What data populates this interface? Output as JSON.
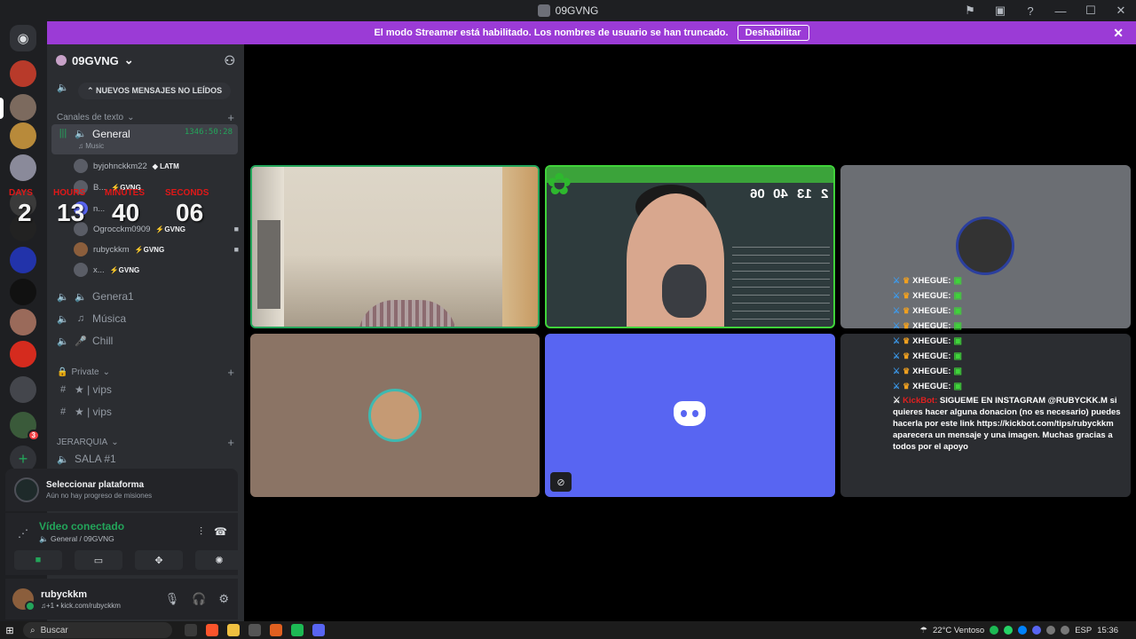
{
  "window": {
    "title": "09GVNG"
  },
  "banner": {
    "text": "El modo Streamer está habilitado. Los nombres de usuario se han truncado.",
    "button": "Deshabilitar"
  },
  "server": {
    "name": "09GVNG",
    "new_messages": "NUEVOS MENSAJES NO LEÍDOS"
  },
  "categories": {
    "text": "Canales de texto",
    "private": "Private",
    "jerarquia": "JERARQUIA"
  },
  "channels": {
    "general": {
      "name": "General",
      "sub": "Music",
      "timer": "1346:50:28"
    },
    "general1": "Genera1",
    "musica": "Música",
    "chill": "Chill",
    "vips1": "★ | vips",
    "vips2": "★ | vips",
    "sala1": "SALA #1"
  },
  "members": [
    {
      "name": "byjohnckkm22",
      "tag": "LATM"
    },
    {
      "name": "B...",
      "tag": "GVNG"
    },
    {
      "name": "n..."
    },
    {
      "name": "Ogrocckm0909",
      "tag": "GVNG"
    },
    {
      "name": "rubyckkm",
      "tag": "GVNG"
    },
    {
      "name": "x...",
      "tag": "GVNG"
    }
  ],
  "overlay_timer": {
    "days_label": "DAYS",
    "hours_label": "HOURS",
    "minutes_label": "MINUTES",
    "seconds_label": "SECONDS",
    "days": "2",
    "hours": "13",
    "minutes": "40",
    "seconds": "06"
  },
  "stream_timer": {
    "days": "2",
    "hours": "13",
    "minutes": "40",
    "seconds": "06"
  },
  "quest_panel": {
    "title": "Seleccionar plataforma",
    "subtitle": "Aún no hay progreso de misiones"
  },
  "voice": {
    "status": "Vídeo conectado",
    "location": "General / 09GVNG"
  },
  "user": {
    "name": "rubyckkm",
    "status": "♫+1 • kick.com/rubyckkm"
  },
  "chat_overlay": {
    "rows": [
      "XHEGUE:",
      "XHEGUE:",
      "XHEGUE:",
      "XHEGUE:",
      "XHEGUE:",
      "XHEGUE:",
      "XHEGUE:",
      "XHEGUE:"
    ],
    "bot_name": "KickBot:",
    "bot_message": "SIGUEME EN INSTAGRAM @RUBYCKK.M si quieres hacer alguna donacion (no es necesario) puedes hacerla por este link https://kickbot.com/tips/rubyckkm aparecera un mensaje y una imagen. Muchas gracias a todos por el apoyo"
  },
  "taskbar": {
    "search": "Buscar",
    "weather": "22°C  Ventoso",
    "lang": "ESP",
    "time": "15:36"
  },
  "colors": {
    "accent": "#5865f2",
    "banner": "#9b3bd6",
    "connected": "#23a55a",
    "timer_label": "#e01818"
  }
}
